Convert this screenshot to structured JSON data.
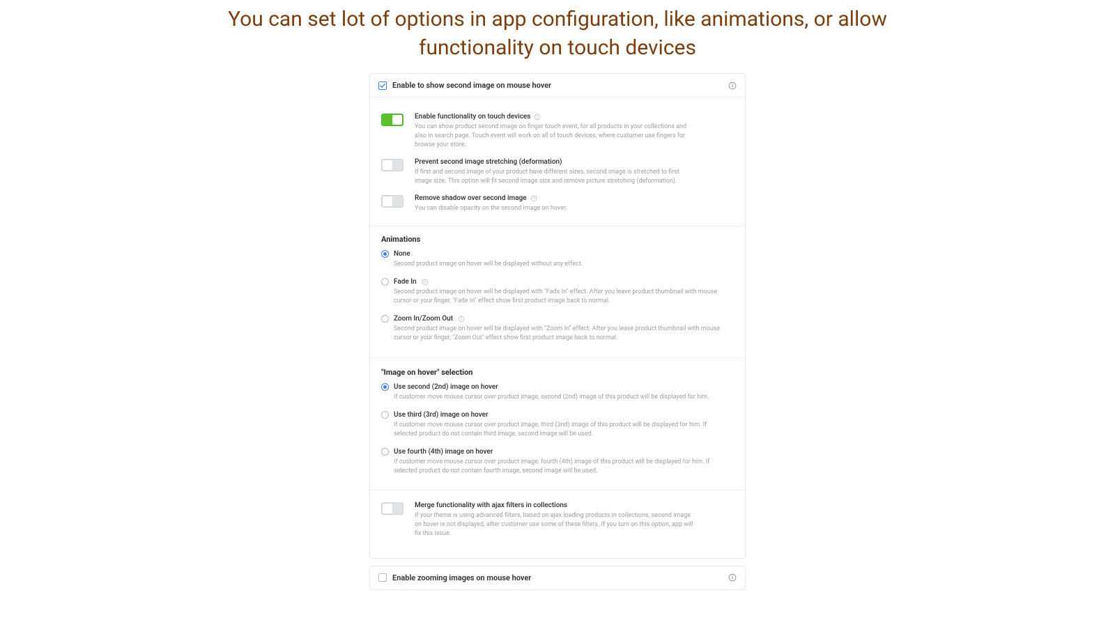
{
  "page": {
    "title": "You can set lot of options in app configuration, like animations, or allow functionality on touch devices"
  },
  "card1": {
    "header_label": "Enable to show second image on mouse hover",
    "header_checked": true
  },
  "toggles": {
    "touch": {
      "label": "Enable functionality on touch devices",
      "desc": "You can show product second image on finger touch event, for all products in your collections and also in search page. Touch event will work on all of touch devices, where customer use fingers for browse your store."
    },
    "stretch": {
      "label": "Prevent second image stretching (deformation)",
      "desc": "If first and second image of your product have different sizes, second image is stretched to first image size. This option will fit second image size and remove picture stretching (deformation)."
    },
    "shadow": {
      "label": "Remove shadow over second image",
      "desc": "You can disable opacity on the second image on hover."
    }
  },
  "sections": {
    "anim": "Animations",
    "hoversel": "\"Image on hover\" selection"
  },
  "anim": {
    "none": {
      "label": "None",
      "desc": "Second product image on hover will be displayed without any effect."
    },
    "fade": {
      "label": "Fade In",
      "desc": "Second product image on hover will be displayed with \"Fade In\" effect. After you leave product thumbnail with mouse cursor or your finger, \"Fade In\" effect show first product image back to normal."
    },
    "zoom": {
      "label": "Zoom In/Zoom Out",
      "desc": "Second product image on hover will be displayed with \"Zoom In\" effect. After you leave product thumbnail with mouse cursor or your finger, \"Zoom Out\" effect show first product image back to normal."
    }
  },
  "hoversel": {
    "second": {
      "label": "Use second (2nd) image on hover",
      "desc": "If customer move mouse cursor over product image, second (2nd) image of this product will be displayed for him."
    },
    "third": {
      "label": "Use third (3rd) image on hover",
      "desc": "If customer move mouse cursor over product image, third (3nd) image of this product will be displayed for him. If selected product do not contain third image, second image will be used."
    },
    "fourth": {
      "label": "Use fourth (4th) image on hover",
      "desc": "If customer move mouse cursor over product image, fourth (4th) image of this product will be displayed for him. If selected product do not contain fourth image, second image will be used."
    }
  },
  "merge": {
    "label": "Merge functionality with ajax filters in collections",
    "desc": "If your theme is using advanced filters, based on ajax loading products in collections, second image on hover is not displayed, after customer use some of these filters. If you turn on this option, app will fix this issue."
  },
  "card2": {
    "header_label": "Enable zooming images on mouse hover"
  }
}
